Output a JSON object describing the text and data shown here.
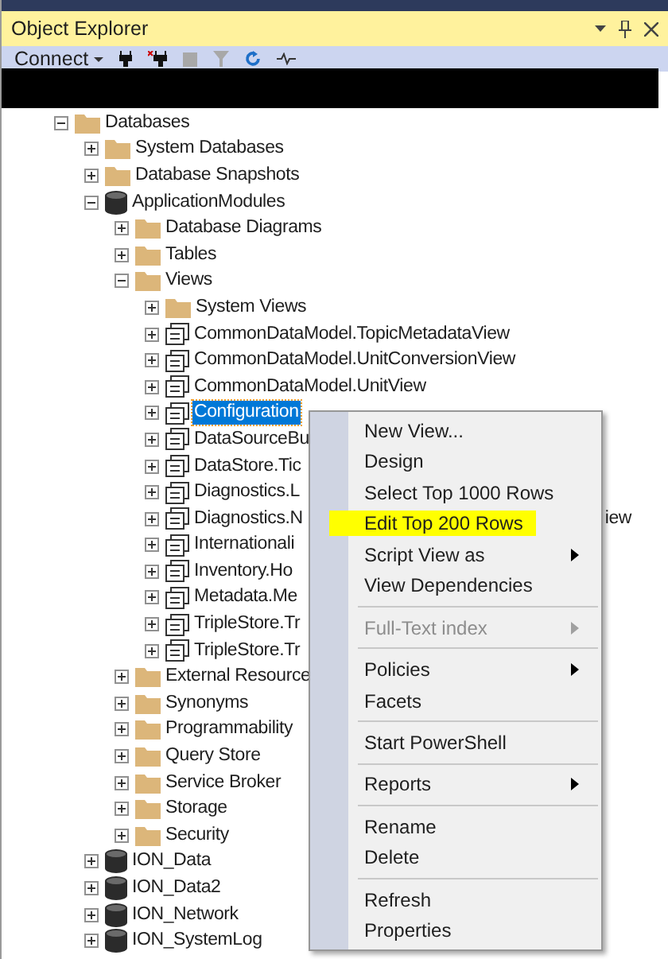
{
  "panel": {
    "title": "Object Explorer"
  },
  "toolbar": {
    "connect_label": "Connect"
  },
  "tree": [
    {
      "label": "Databases",
      "kind": "folder",
      "expanded": true,
      "children": [
        {
          "label": "System Databases",
          "kind": "folder",
          "expanded": false
        },
        {
          "label": "Database Snapshots",
          "kind": "folder",
          "expanded": false
        },
        {
          "label": "ApplicationModules",
          "kind": "database",
          "expanded": true,
          "children": [
            {
              "label": "Database Diagrams",
              "kind": "folder",
              "expanded": false
            },
            {
              "label": "Tables",
              "kind": "folder",
              "expanded": false
            },
            {
              "label": "Views",
              "kind": "folder",
              "expanded": true,
              "children": [
                {
                  "label": "System Views",
                  "kind": "folder",
                  "expanded": false,
                  "selected": false
                },
                {
                  "label": "CommonDataModel.TopicMetadataView",
                  "kind": "view",
                  "expanded": false,
                  "selected": false
                },
                {
                  "label": "CommonDataModel.UnitConversionView",
                  "kind": "view",
                  "expanded": false,
                  "selected": false
                },
                {
                  "label": "CommonDataModel.UnitView",
                  "kind": "view",
                  "expanded": false,
                  "selected": false
                },
                {
                  "label": "Configuration",
                  "kind": "view",
                  "expanded": false,
                  "selected": true
                },
                {
                  "label": "DataSourceBu",
                  "kind": "view",
                  "expanded": false,
                  "selected": false
                },
                {
                  "label": "DataStore.Tic",
                  "kind": "view",
                  "expanded": false,
                  "selected": false
                },
                {
                  "label": "Diagnostics.L",
                  "kind": "view",
                  "expanded": false,
                  "selected": false
                },
                {
                  "label": "Diagnostics.N",
                  "kind": "view",
                  "expanded": false,
                  "selected": false,
                  "overflow_text": "iew"
                },
                {
                  "label": "Internationali",
                  "kind": "view",
                  "expanded": false,
                  "selected": false
                },
                {
                  "label": "Inventory.Ho",
                  "kind": "view",
                  "expanded": false,
                  "selected": false
                },
                {
                  "label": "Metadata.Me",
                  "kind": "view",
                  "expanded": false,
                  "selected": false
                },
                {
                  "label": "TripleStore.Tr",
                  "kind": "view",
                  "expanded": false,
                  "selected": false
                },
                {
                  "label": "TripleStore.Tr",
                  "kind": "view",
                  "expanded": false,
                  "selected": false
                }
              ]
            },
            {
              "label": "External Resource",
              "kind": "folder",
              "expanded": false
            },
            {
              "label": "Synonyms",
              "kind": "folder",
              "expanded": false
            },
            {
              "label": "Programmability",
              "kind": "folder",
              "expanded": false
            },
            {
              "label": "Query Store",
              "kind": "folder",
              "expanded": false
            },
            {
              "label": "Service Broker",
              "kind": "folder",
              "expanded": false
            },
            {
              "label": "Storage",
              "kind": "folder",
              "expanded": false
            },
            {
              "label": "Security",
              "kind": "folder",
              "expanded": false
            }
          ]
        },
        {
          "label": "ION_Data",
          "kind": "database",
          "expanded": false
        },
        {
          "label": "ION_Data2",
          "kind": "database",
          "expanded": false
        },
        {
          "label": "ION_Network",
          "kind": "database",
          "expanded": false
        },
        {
          "label": "ION_SystemLog",
          "kind": "database",
          "expanded": false
        }
      ]
    }
  ],
  "context_menu": [
    {
      "kind": "item",
      "label": "New View...",
      "submenu": false,
      "disabled": false,
      "highlighted": false
    },
    {
      "kind": "item",
      "label": "Design",
      "submenu": false,
      "disabled": false,
      "highlighted": false
    },
    {
      "kind": "item",
      "label": "Select Top 1000 Rows",
      "submenu": false,
      "disabled": false,
      "highlighted": false
    },
    {
      "kind": "item",
      "label": "Edit Top 200 Rows",
      "submenu": false,
      "disabled": false,
      "highlighted": true
    },
    {
      "kind": "item",
      "label": "Script View as",
      "submenu": true,
      "disabled": false,
      "highlighted": false
    },
    {
      "kind": "item",
      "label": "View Dependencies",
      "submenu": false,
      "disabled": false,
      "highlighted": false
    },
    {
      "kind": "separator"
    },
    {
      "kind": "item",
      "label": "Full-Text index",
      "submenu": true,
      "disabled": true,
      "highlighted": false
    },
    {
      "kind": "separator"
    },
    {
      "kind": "item",
      "label": "Policies",
      "submenu": true,
      "disabled": false,
      "highlighted": false
    },
    {
      "kind": "item",
      "label": "Facets",
      "submenu": false,
      "disabled": false,
      "highlighted": false
    },
    {
      "kind": "separator"
    },
    {
      "kind": "item",
      "label": "Start PowerShell",
      "submenu": false,
      "disabled": false,
      "highlighted": false
    },
    {
      "kind": "separator"
    },
    {
      "kind": "item",
      "label": "Reports",
      "submenu": true,
      "disabled": false,
      "highlighted": false
    },
    {
      "kind": "separator"
    },
    {
      "kind": "item",
      "label": "Rename",
      "submenu": false,
      "disabled": false,
      "highlighted": false
    },
    {
      "kind": "item",
      "label": "Delete",
      "submenu": false,
      "disabled": false,
      "highlighted": false
    },
    {
      "kind": "separator"
    },
    {
      "kind": "item",
      "label": "Refresh",
      "submenu": false,
      "disabled": false,
      "highlighted": false
    },
    {
      "kind": "item",
      "label": "Properties",
      "submenu": false,
      "disabled": false,
      "highlighted": false
    }
  ]
}
